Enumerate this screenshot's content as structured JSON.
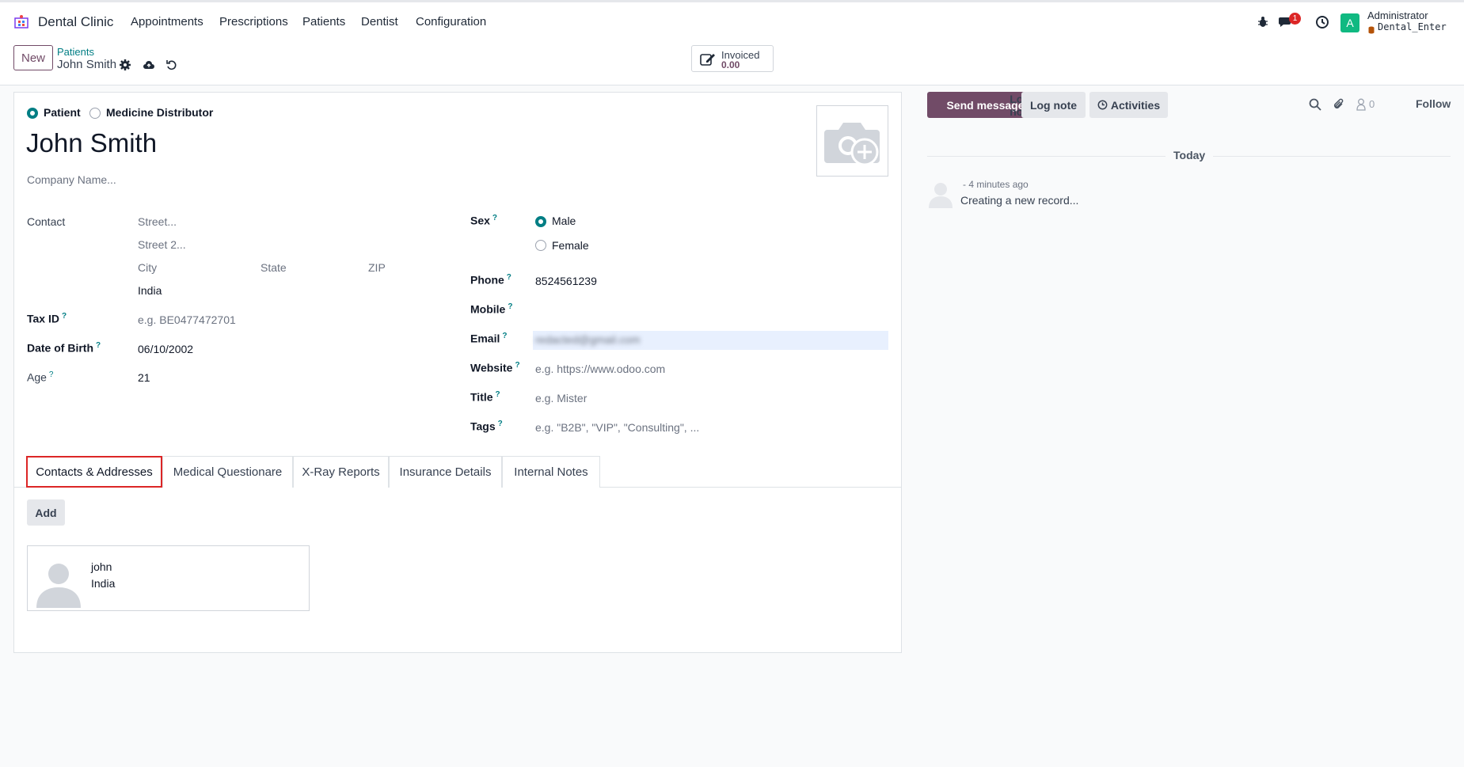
{
  "topbar": {
    "app_name": "Dental Clinic",
    "menu": [
      "Appointments",
      "Prescriptions",
      "Patients",
      "Dentist",
      "Configuration"
    ],
    "messages_badge": "1",
    "avatar_letter": "A",
    "user_name": "Administrator",
    "database": "Dental_Enter"
  },
  "control": {
    "new_label": "New",
    "breadcrumb_parent": "Patients",
    "breadcrumb_current": "John Smith",
    "smart_label": "Invoiced",
    "smart_value": "0.00"
  },
  "form": {
    "type_patient": "Patient",
    "type_distributor": "Medicine Distributor",
    "name": "John Smith",
    "company_placeholder": "Company Name...",
    "contact_label": "Contact",
    "street_ph": "Street...",
    "street2_ph": "Street 2...",
    "city_ph": "City",
    "state_ph": "State",
    "zip_ph": "ZIP",
    "country": "India",
    "taxid_label": "Tax ID",
    "taxid_ph": "e.g. BE0477472701",
    "dob_label": "Date of Birth",
    "dob": "06/10/2002",
    "age_label": "Age",
    "age": "21",
    "sex_label": "Sex",
    "sex_male": "Male",
    "sex_female": "Female",
    "phone_label": "Phone",
    "phone": "8524561239",
    "mobile_label": "Mobile",
    "email_label": "Email",
    "email": "redacted@gmail.com",
    "website_label": "Website",
    "website_ph": "e.g. https://www.odoo.com",
    "title_label": "Title",
    "title_ph": "e.g. Mister",
    "tags_label": "Tags",
    "tags_ph": "e.g. \"B2B\", \"VIP\", \"Consulting\", ...",
    "help_mark": "?"
  },
  "tabs": [
    "Contacts & Addresses",
    "Medical Questionare",
    "X-Ray Reports",
    "Insurance Details",
    "Internal Notes"
  ],
  "contacts": {
    "add_label": "Add",
    "card_name": "john",
    "card_country": "India"
  },
  "chatter": {
    "send_message": "Send message",
    "log_note": "Log note",
    "activities": "Activities",
    "followers_count": "0",
    "follow": "Follow",
    "today": "Today",
    "msg_time": "- 4 minutes ago",
    "msg_body": "Creating a new record..."
  },
  "colors": {
    "primary": "#714b67",
    "accent": "#017e84",
    "badge": "#dc2626",
    "avatar": "#10b981"
  }
}
